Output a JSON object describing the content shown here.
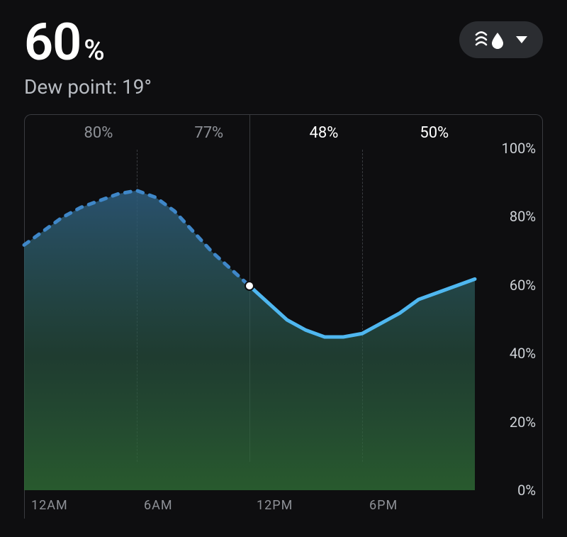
{
  "header": {
    "value": "60",
    "unit": "%",
    "sub": "Dew point: 19°"
  },
  "selector": {
    "icon": "humidity-icon",
    "caret": "chevron-down-icon"
  },
  "top_labels": [
    {
      "t": 0.165,
      "text": "80%",
      "period": "past"
    },
    {
      "t": 0.41,
      "text": "77%",
      "period": "past"
    },
    {
      "t": 0.665,
      "text": "48%",
      "period": "future"
    },
    {
      "t": 0.91,
      "text": "50%",
      "period": "future"
    }
  ],
  "yaxis": {
    "ticks": [
      {
        "v": 100,
        "label": "100%"
      },
      {
        "v": 80,
        "label": "80%"
      },
      {
        "v": 60,
        "label": "60%"
      },
      {
        "v": 40,
        "label": "40%"
      },
      {
        "v": 20,
        "label": "20%"
      },
      {
        "v": 0,
        "label": "0%"
      }
    ],
    "min": 0,
    "max": 100
  },
  "xaxis": {
    "ticks": [
      {
        "t": 0.0,
        "label": "12AM"
      },
      {
        "t": 0.25,
        "label": "6AM"
      },
      {
        "t": 0.5,
        "label": "12PM"
      },
      {
        "t": 0.75,
        "label": "6PM"
      }
    ]
  },
  "now_t": 0.5,
  "chart_data": {
    "type": "area",
    "title": "Humidity",
    "xlabel": "",
    "ylabel": "",
    "ylim": [
      0,
      100
    ],
    "x_hours": [
      0,
      1,
      2,
      3,
      4,
      5,
      6,
      7,
      8,
      9,
      10,
      11,
      12,
      13,
      14,
      15,
      16,
      17,
      18,
      19,
      20,
      21,
      22,
      23,
      24
    ],
    "series": [
      {
        "name": "humidity_pct",
        "values": [
          72,
          76,
          80,
          83,
          85,
          87,
          88,
          86,
          82,
          76,
          70,
          65,
          60,
          55,
          50,
          47,
          45,
          45,
          46,
          49,
          52,
          56,
          58,
          60,
          62
        ]
      }
    ],
    "current_index": 12,
    "current_value": 60,
    "colors": {
      "line_past": "#3f87c8",
      "line_future": "#4fb7f0",
      "fill_top": "#2e5d7f",
      "fill_bottom": "#2f6d35",
      "dot": "#ffffff"
    }
  }
}
